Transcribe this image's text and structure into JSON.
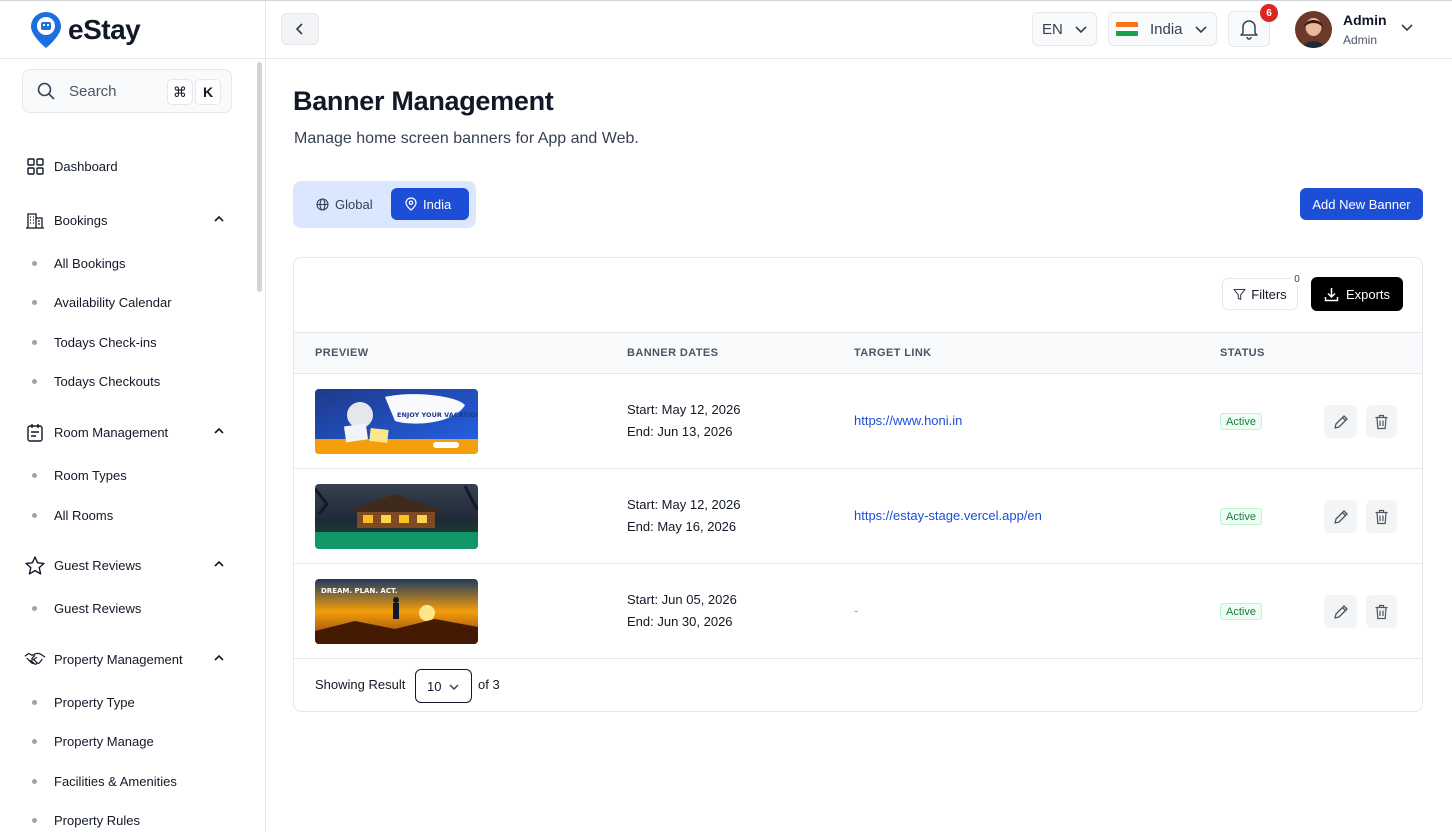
{
  "brand": {
    "name": "eStay"
  },
  "search": {
    "label": "Search",
    "shortcut_cmd": "⌘",
    "shortcut_key": "K"
  },
  "sidebar": {
    "dashboard": "Dashboard",
    "bookings": {
      "label": "Bookings",
      "items": [
        "All Bookings",
        "Availability Calendar",
        "Todays Check-ins",
        "Todays Checkouts"
      ]
    },
    "room_management": {
      "label": "Room Management",
      "items": [
        "Room Types",
        "All Rooms"
      ]
    },
    "guest_reviews": {
      "label": "Guest Reviews",
      "items": [
        "Guest Reviews"
      ]
    },
    "property_management": {
      "label": "Property Management",
      "items": [
        "Property Type",
        "Property Manage",
        "Facilities & Amenities",
        "Property Rules"
      ]
    }
  },
  "header": {
    "language": "EN",
    "country": "India",
    "notifications_count": "6",
    "user_name": "Admin",
    "user_role": "Admin"
  },
  "page": {
    "title": "Banner Management",
    "subtitle": "Manage home screen banners for App and Web."
  },
  "segment": {
    "global": "Global",
    "india": "India",
    "active": "India"
  },
  "actions": {
    "add_banner": "Add New Banner",
    "filters": "Filters",
    "filters_count": "0",
    "exports": "Exports"
  },
  "table": {
    "headers": {
      "preview": "PREVIEW",
      "dates": "BANNER DATES",
      "link": "TARGET LINK",
      "status": "STATUS"
    },
    "rows": [
      {
        "start": "Start: May 12, 2026",
        "end": "End: Jun 13, 2026",
        "link": "https://www.honi.in",
        "status": "Active",
        "thumb_text": "ENJOY YOUR VACATIONS"
      },
      {
        "start": "Start: May 12, 2026",
        "end": "End: May 16, 2026",
        "link": "https://estay-stage.vercel.app/en",
        "status": "Active"
      },
      {
        "start": "Start: Jun 05, 2026",
        "end": "End: Jun 30, 2026",
        "link": "-",
        "status": "Active",
        "thumb_text": "DREAM. PLAN. ACT."
      }
    ]
  },
  "pagination": {
    "label": "Showing Result",
    "page_size": "10",
    "total": "of 3"
  },
  "colors": {
    "primary": "#1d4ed8",
    "active_bg": "#f0fdf4",
    "active_text": "#15803d",
    "badge": "#dc2626"
  }
}
